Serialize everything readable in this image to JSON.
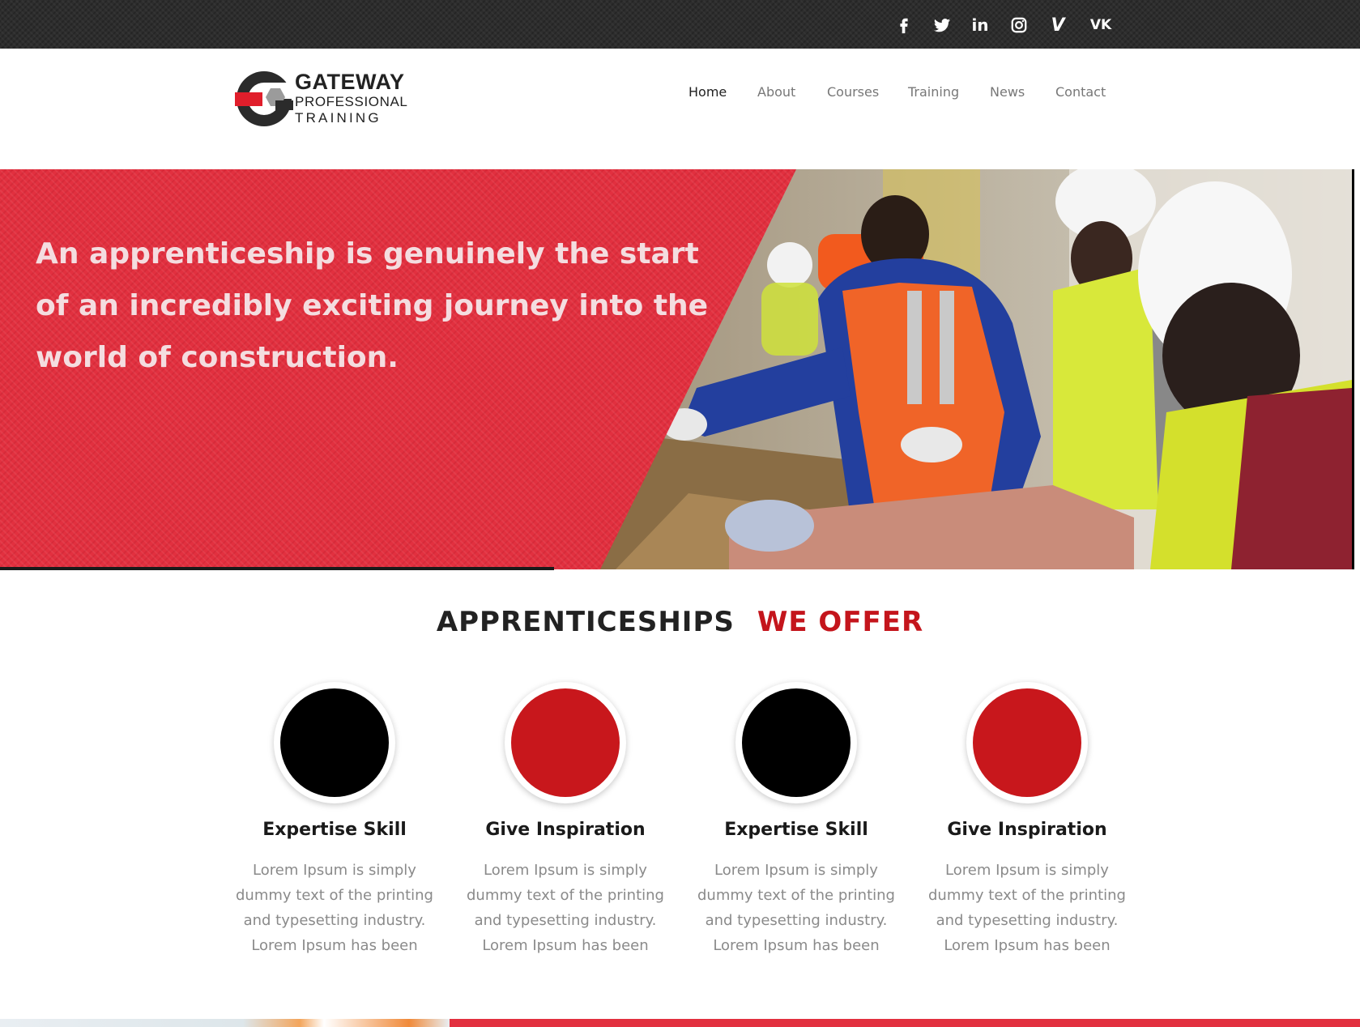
{
  "social": [
    {
      "name": "facebook"
    },
    {
      "name": "twitter"
    },
    {
      "name": "linkedin",
      "label": "in"
    },
    {
      "name": "instagram"
    },
    {
      "name": "vimeo",
      "label": "V"
    },
    {
      "name": "vk",
      "label": "VK"
    }
  ],
  "logo": {
    "line1": "GATEWAY",
    "line2": "PROFESSIONAL",
    "line3": "TRAINING"
  },
  "nav": {
    "items": [
      "Home",
      "About",
      "Courses",
      "Training",
      "News",
      "Contact"
    ],
    "active": "Home"
  },
  "hero": {
    "text": "An apprenticeship is genuinely the start of an incredibly exciting journey into the world of construction."
  },
  "section": {
    "title_part1": "APPRENTICESHIPS",
    "title_part2": "WE OFFER"
  },
  "features": [
    {
      "title": "Expertise Skill",
      "text": "Lorem Ipsum is simply dummy text of the printing and typesetting industry. Lorem Ipsum has been",
      "color": "#000000"
    },
    {
      "title": "Give Inspiration",
      "text": "Lorem Ipsum is simply dummy text of the printing and typesetting industry. Lorem Ipsum has been",
      "color": "#c8171c"
    },
    {
      "title": "Expertise Skill",
      "text": "Lorem Ipsum is simply dummy text of the printing and typesetting industry. Lorem Ipsum has been",
      "color": "#000000"
    },
    {
      "title": "Give Inspiration",
      "text": "Lorem Ipsum is simply dummy text of the printing and typesetting industry. Lorem Ipsum has been",
      "color": "#c8171c"
    }
  ],
  "colors": {
    "brand_red": "#e2303f",
    "accent_red": "#c4151c",
    "dark": "#2d2d2d"
  }
}
